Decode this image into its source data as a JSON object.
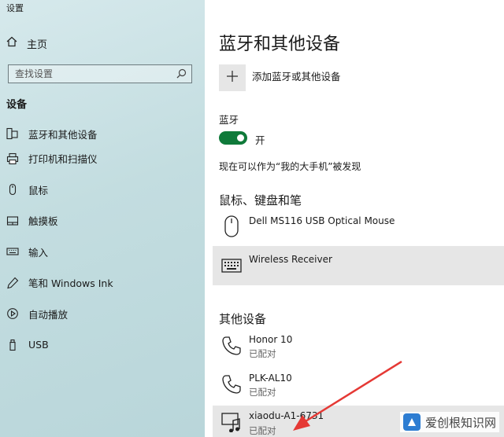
{
  "window": {
    "title": "设置"
  },
  "sidebar": {
    "home_label": "主页",
    "search_placeholder": "查找设置",
    "section": "设备",
    "items": [
      {
        "label": "蓝牙和其他设备",
        "icon": "bluetooth-devices-icon"
      },
      {
        "label": "打印机和扫描仪",
        "icon": "printer-icon"
      },
      {
        "label": "鼠标",
        "icon": "mouse-icon"
      },
      {
        "label": "触摸板",
        "icon": "touchpad-icon"
      },
      {
        "label": "输入",
        "icon": "keyboard-icon"
      },
      {
        "label": "笔和 Windows Ink",
        "icon": "pen-icon"
      },
      {
        "label": "自动播放",
        "icon": "autoplay-icon"
      },
      {
        "label": "USB",
        "icon": "usb-icon"
      }
    ]
  },
  "main": {
    "title": "蓝牙和其他设备",
    "add_label": "添加蓝牙或其他设备",
    "bluetooth_label": "蓝牙",
    "bluetooth_state": "开",
    "bluetooth_on": true,
    "discoverable": "现在可以作为“我的大手机”被发现",
    "input_section": "鼠标、键盘和笔",
    "input_devices": [
      {
        "name": "Dell MS116 USB Optical Mouse",
        "icon": "mouse-icon"
      },
      {
        "name": "Wireless Receiver",
        "icon": "keyboard-icon"
      }
    ],
    "other_section": "其他设备",
    "other_devices": [
      {
        "name": "Honor 10",
        "status": "已配对",
        "icon": "phone-icon"
      },
      {
        "name": "PLK-AL10",
        "status": "已配对",
        "icon": "phone-icon"
      },
      {
        "name": "xiaodu-A1-6731",
        "status": "已配对",
        "icon": "speaker-icon"
      }
    ]
  },
  "watermark": {
    "text": "爱创根知识网"
  },
  "colors": {
    "toggle_on": "#0f7a3a",
    "annotation_arrow": "#e53935"
  }
}
